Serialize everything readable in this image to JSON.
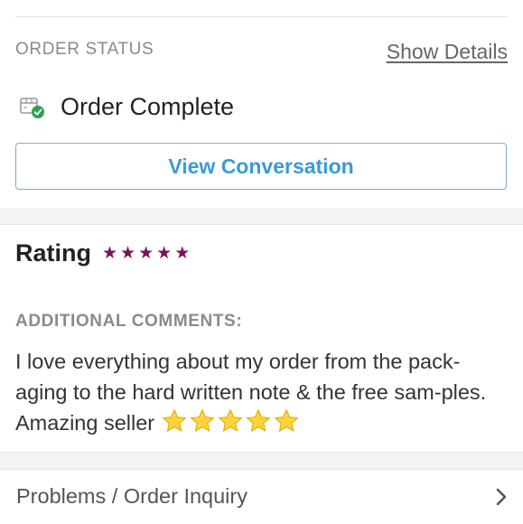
{
  "order_status": {
    "label": "ORDER STATUS",
    "show_details": "Show Details",
    "status": "Order Complete",
    "status_icon": "package-check-icon",
    "view_conversation": "View Conversation"
  },
  "rating": {
    "title": "Rating",
    "stars": 5,
    "star_color": "#7a1357"
  },
  "comments": {
    "label": "ADDITIONAL COMMENTS:",
    "text": "I love everything about my order from the pack-aging to the hard written note & the free sam-ples. Amazing seller",
    "emoji": "star-emoji",
    "emoji_count": 5
  },
  "problems": {
    "label": "Problems / Order Inquiry",
    "icon": "chevron-right-icon"
  },
  "colors": {
    "accent_blue": "#3a9ad8",
    "check_green": "#2e9e4f"
  }
}
